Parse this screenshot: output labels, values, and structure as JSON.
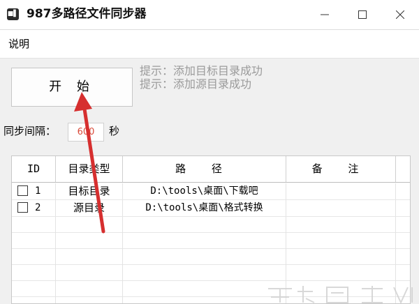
{
  "window": {
    "title": "987多路径文件同步器",
    "icon": "app-icon",
    "icon_text": "■▌"
  },
  "menu": {
    "items": [
      "说明"
    ]
  },
  "toolbar": {
    "start_label": "开 始"
  },
  "hints": [
    "提示：添加目标目录成功",
    "提示：添加源目录成功"
  ],
  "interval": {
    "label": "同步间隔：",
    "value": "600",
    "unit": "秒"
  },
  "table": {
    "columns": [
      "ID",
      "目录类型",
      "路 径",
      "备 注"
    ],
    "rows": [
      {
        "id": "1",
        "type": "目标目录",
        "path": "D:\\tools\\桌面\\下载吧",
        "note": "",
        "checked": false
      },
      {
        "id": "2",
        "type": "源目录",
        "path": "D:\\tools\\桌面\\格式转换",
        "note": "",
        "checked": false
      }
    ]
  },
  "colors": {
    "accent_red": "#d62f2f",
    "hint_gray": "#9a9a9a",
    "interval_value": "#d94a3a"
  }
}
